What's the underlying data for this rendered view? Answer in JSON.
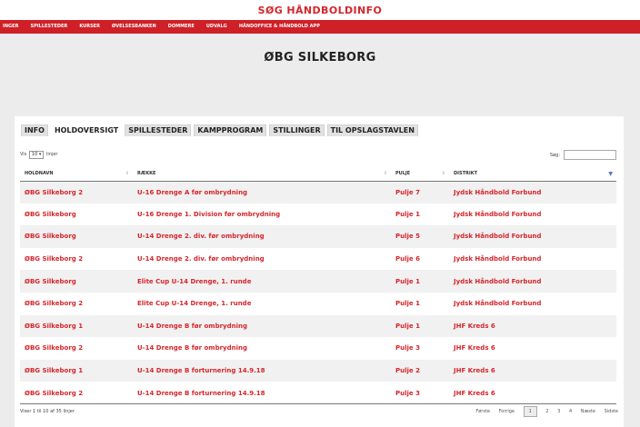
{
  "header": {
    "title": "SØG HÅNDBOLDINFO"
  },
  "nav": {
    "items": [
      "INGER",
      "SPILLESTEDER",
      "KURSER",
      "ØVELSESBANKEN",
      "DOMMERE",
      "UDVALG",
      "HÅNDOFFICE & HÅNDBOLD APP"
    ]
  },
  "club": {
    "title": "ØBG SILKEBORG"
  },
  "tabs": [
    {
      "label": "INFO"
    },
    {
      "label": "HOLDOVERSIGT"
    },
    {
      "label": "SPILLESTEDER"
    },
    {
      "label": "KAMPPROGRAM"
    },
    {
      "label": "STILLINGER"
    },
    {
      "label": "TIL OPSLAGSTAVLEN"
    }
  ],
  "controls": {
    "show_prefix": "Vis",
    "show_value": "10",
    "show_suffix": "linjer",
    "search_label": "Søg:"
  },
  "table": {
    "headers": {
      "team": "HOLDNAVN",
      "row": "RÆKKE",
      "pool": "PULJE",
      "district": "DISTRIKT"
    },
    "rows": [
      {
        "team": "ØBG Silkeborg 2",
        "row": "U-16 Drenge A før ombrydning",
        "pool": "Pulje 7",
        "district": "Jydsk Håndbold Forbund"
      },
      {
        "team": "ØBG Silkeborg",
        "row": "U-16 Drenge 1. Division før ombrydning",
        "pool": "Pulje 1",
        "district": "Jydsk Håndbold Forbund"
      },
      {
        "team": "ØBG Silkeborg",
        "row": "U-14 Drenge 2. div. før ombrydning",
        "pool": "Pulje 5",
        "district": "Jydsk Håndbold Forbund"
      },
      {
        "team": "ØBG Silkeborg 2",
        "row": "U-14 Drenge 2. div. før ombrydning",
        "pool": "Pulje 6",
        "district": "Jydsk Håndbold Forbund"
      },
      {
        "team": "ØBG Silkeborg",
        "row": "Elite Cup U-14 Drenge, 1. runde",
        "pool": "Pulje 1",
        "district": "Jydsk Håndbold Forbund"
      },
      {
        "team": "ØBG Silkeborg 2",
        "row": "Elite Cup U-14 Drenge, 1. runde",
        "pool": "Pulje 1",
        "district": "Jydsk Håndbold Forbund"
      },
      {
        "team": "ØBG Silkeborg 1",
        "row": "U-14 Drenge B før ombrydning",
        "pool": "Pulje 1",
        "district": "JHF Kreds 6"
      },
      {
        "team": "ØBG Silkeborg 2",
        "row": "U-14 Drenge B før ombrydning",
        "pool": "Pulje 3",
        "district": "JHF Kreds 6"
      },
      {
        "team": "ØBG Silkeborg 1",
        "row": "U-14 Drenge B forturnering 14.9.18",
        "pool": "Pulje 2",
        "district": "JHF Kreds 6"
      },
      {
        "team": "ØBG Silkeborg 2",
        "row": "U-14 Drenge B forturnering 14.9.18",
        "pool": "Pulje 3",
        "district": "JHF Kreds 6"
      }
    ]
  },
  "footer": {
    "info": "Viser 1 til 10 af 35 linjer",
    "pager": {
      "first": "Første",
      "prev": "Forrige",
      "pages": [
        "1",
        "2",
        "3",
        "4"
      ],
      "next": "Næste",
      "last": "Sidste"
    }
  },
  "icons": {
    "sort": "sort-icon",
    "sort_active": "sort-desc-icon",
    "dropdown": "chevron-down-icon"
  },
  "colors": {
    "brand": "#cf2027",
    "link": "#d4262c"
  }
}
